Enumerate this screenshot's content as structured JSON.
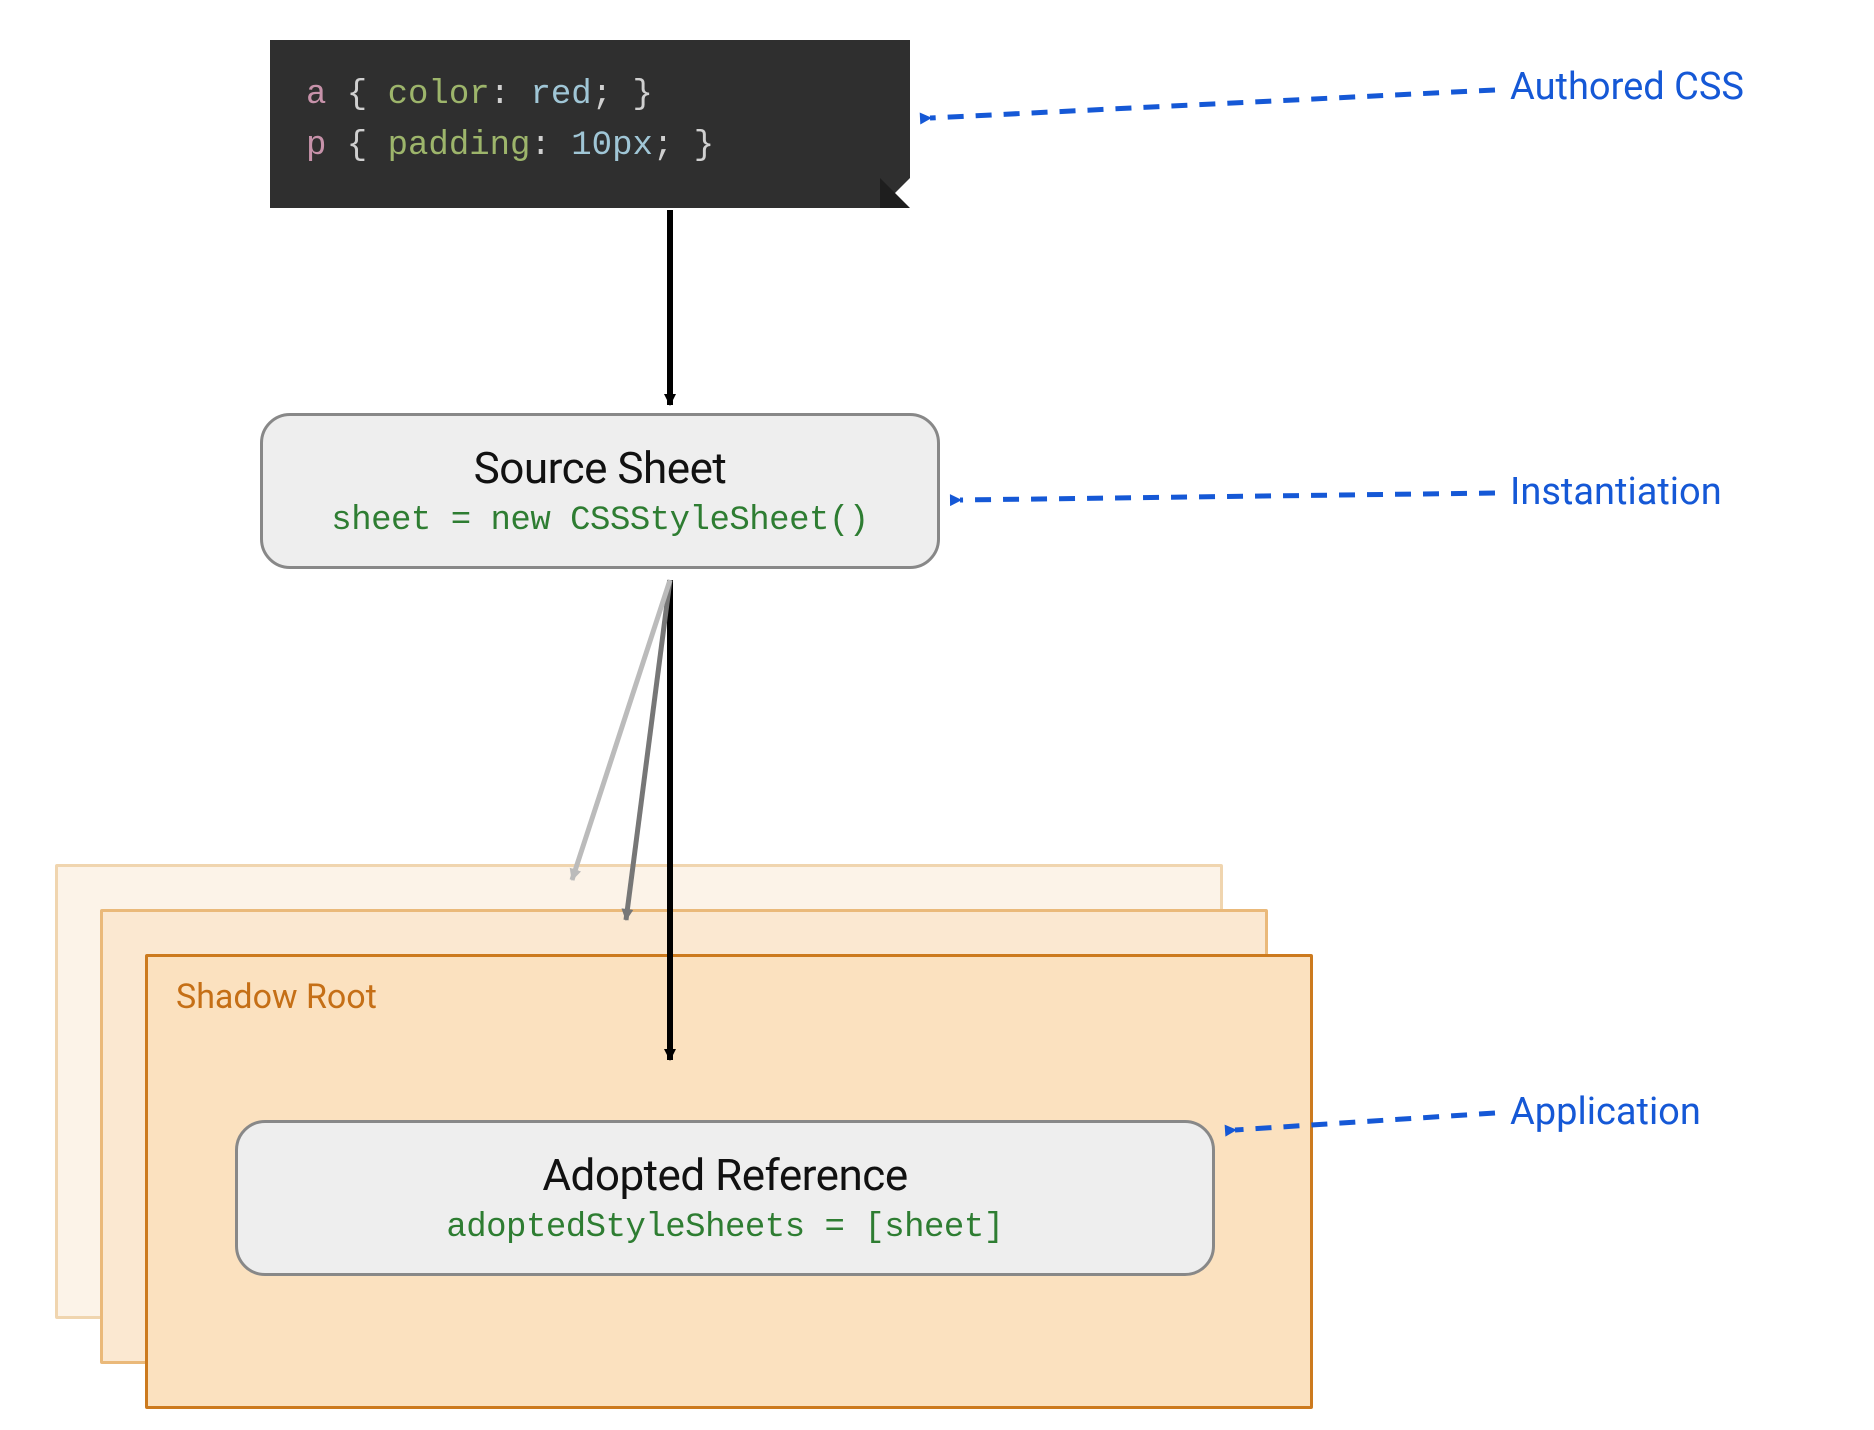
{
  "code": {
    "line1": {
      "selector": "a",
      "open": " { ",
      "prop": "color",
      "colon": ": ",
      "value": "red",
      "close": "; }"
    },
    "line2": {
      "selector": "p",
      "open": " { ",
      "prop": "padding",
      "colon": ": ",
      "value": "10px",
      "close": "; }"
    }
  },
  "sourceSheet": {
    "title": "Source Sheet",
    "mono": "sheet = new CSSStyleSheet()"
  },
  "shadowRoot": {
    "label": "Shadow Root"
  },
  "adopted": {
    "title": "Adopted Reference",
    "mono": "adoptedStyleSheets = [sheet]"
  },
  "annotations": {
    "authored": "Authored CSS",
    "instantiation": "Instantiation",
    "application": "Application"
  }
}
